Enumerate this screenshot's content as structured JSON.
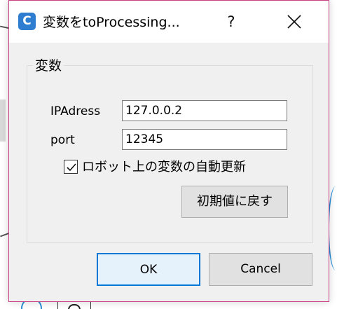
{
  "window": {
    "app_icon_letter": "C",
    "title": "変数をtoProcessing...",
    "help_label": "?",
    "accent_color": "#c93f86",
    "icon_color": "#2f7dd1"
  },
  "group": {
    "title": "変数"
  },
  "fields": {
    "ip_label": "IPAdress",
    "ip_value": "127.0.0.2",
    "port_label": "port",
    "port_value": "12345"
  },
  "checkbox": {
    "label": "ロボット上の変数の自動更新",
    "checked": true
  },
  "buttons": {
    "reset_label": "初期値に戻す",
    "ok_label": "OK",
    "cancel_label": "Cancel",
    "default_border_color": "#0078d7"
  }
}
